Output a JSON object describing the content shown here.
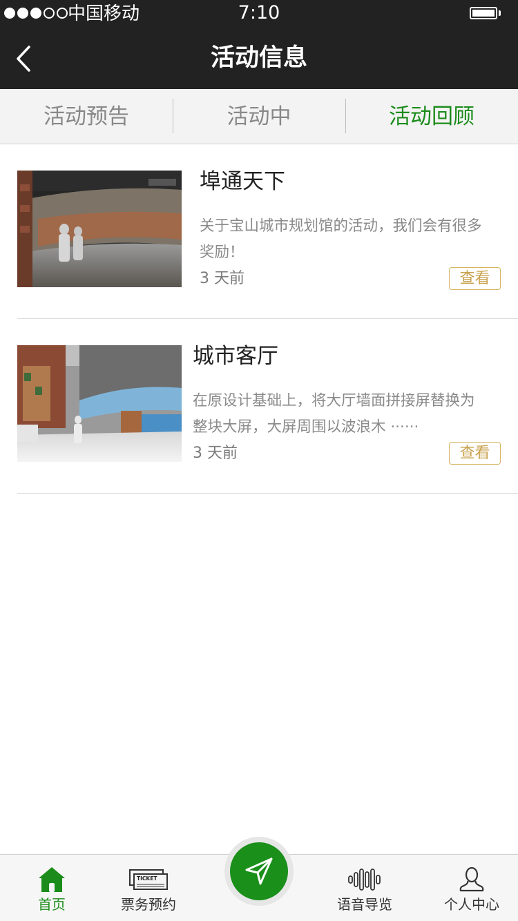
{
  "status_bar": {
    "carrier": "中国移动",
    "time": "7:10",
    "signal_filled": 3,
    "signal_total": 5
  },
  "nav": {
    "title": "活动信息",
    "back_icon": "chevron-left-icon"
  },
  "tabs": [
    {
      "label": "活动预告",
      "active": false
    },
    {
      "label": "活动中",
      "active": false
    },
    {
      "label": "活动回顾",
      "active": true
    }
  ],
  "activities": [
    {
      "title": "埠通天下",
      "description": "关于宝山城市规划馆的活动，我们会有很多奖励！",
      "time": "3 天前",
      "view_label": "查看",
      "image": "exhibition-hall-photo"
    },
    {
      "title": "城市客厅",
      "description": "在原设计基础上，将大厅墙面拼接屏替换为整块大屏，大屏周围以波浪木 ······",
      "time": "3 天前",
      "view_label": "查看",
      "image": "city-lobby-photo"
    }
  ],
  "tabbar": {
    "items": [
      {
        "label": "首页",
        "icon": "home-icon",
        "active": true
      },
      {
        "label": "票务预约",
        "icon": "ticket-icon",
        "active": false
      },
      {
        "label": "",
        "icon": "navigation-arrow-icon",
        "active": false
      },
      {
        "label": "语音导览",
        "icon": "sound-wave-icon",
        "active": false
      },
      {
        "label": "个人中心",
        "icon": "user-icon",
        "active": false
      }
    ],
    "ticket_icon_text": "TICKET"
  },
  "colors": {
    "accent_green": "#1b8c1b",
    "dark_bar": "#222222",
    "gold": "#c9a14e"
  }
}
